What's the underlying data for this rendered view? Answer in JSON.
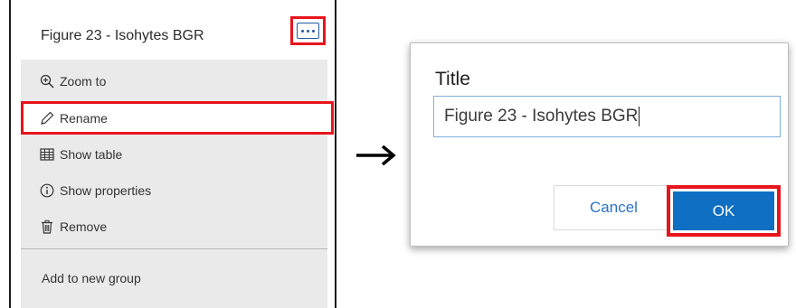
{
  "layer_panel": {
    "title": "Figure 23 - Isohytes BGR",
    "more_icon": "ellipsis-icon",
    "menu_items": [
      {
        "label": "Zoom to",
        "icon": "zoom-in-icon"
      },
      {
        "label": "Rename",
        "icon": "pencil-icon",
        "highlighted": true
      },
      {
        "label": "Show table",
        "icon": "table-icon"
      },
      {
        "label": "Show properties",
        "icon": "info-icon"
      },
      {
        "label": "Remove",
        "icon": "trash-icon"
      }
    ],
    "group_item": {
      "label": "Add to new group"
    }
  },
  "arrow_icon": "right-arrow-icon",
  "dialog": {
    "label": "Title",
    "input_value": "Figure 23 - Isohytes BGR",
    "cancel_label": "Cancel",
    "ok_label": "OK"
  },
  "colors": {
    "highlight": "#e8141c",
    "accent": "#0f6fc3",
    "link": "#2a72c4",
    "menu_bg": "#eaeaea"
  }
}
